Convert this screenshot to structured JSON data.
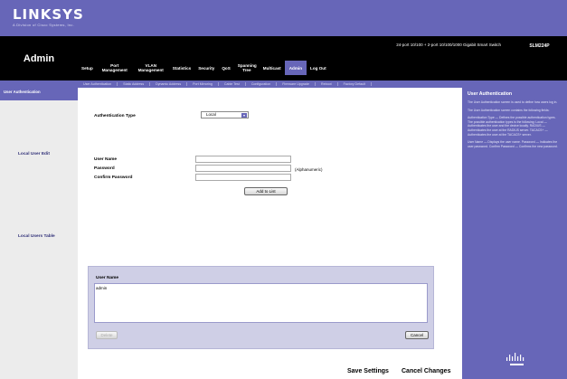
{
  "brand": {
    "logo": "LINKSYS",
    "tagline": "A Division of Cisco Systems, Inc."
  },
  "header": {
    "section": "Admin",
    "device_info": "24-port 10/100 + 2-port 10/100/1000 Gigabit Smart Switch",
    "model": "SLM224P"
  },
  "nav": {
    "items": [
      "Setup",
      "Port Management",
      "VLAN Management",
      "Statistics",
      "Security",
      "QoS",
      "Spanning Tree",
      "Multicast",
      "Admin",
      "Log Out"
    ],
    "active": "Admin"
  },
  "subnav": {
    "items": [
      "User Authentication",
      "Static Address",
      "Dynamic Address",
      "Port Mirroring",
      "Cable Test",
      "Configuration",
      "Firmware Upgrade",
      "Reboot",
      "Factory Default"
    ]
  },
  "left": {
    "active_label": "User Authentication",
    "sections": [
      "Local User Edit",
      "Local Users Table"
    ]
  },
  "form": {
    "auth_type_label": "Authentication Type",
    "auth_type_value": "Local",
    "user_name_label": "User Name",
    "password_label": "Password",
    "confirm_password_label": "Confirm Password",
    "password_hint": "(Alphanumeric)",
    "add_to_list": "Add to List"
  },
  "table": {
    "header": "User Name",
    "rows": [
      "admin"
    ],
    "delete": "Delete",
    "cancel": "Cancel"
  },
  "footer": {
    "save": "Save Settings",
    "cancel": "Cancel Changes"
  },
  "help": {
    "title": "User Authentication",
    "paragraphs": [
      "The User Authentication screen is used to define how users log in.",
      "The User Authentication screen contains the following fields:",
      "Authentication Type — Defines the possible authentication types. The possible authentication types is the following: Local — Authenticates the user and the device locally. RADIUS — Authenticates the user at the RADIUS server. TACACS+ — Authenticates the user at the TACACS+ server.",
      "User Name — Displays the user name. Password — Indicates the user password. Confirm Password — Confirms the new password."
    ]
  },
  "colors": {
    "accent": "#6766b8",
    "header_black": "#000000",
    "panel_gray": "#ececec"
  }
}
